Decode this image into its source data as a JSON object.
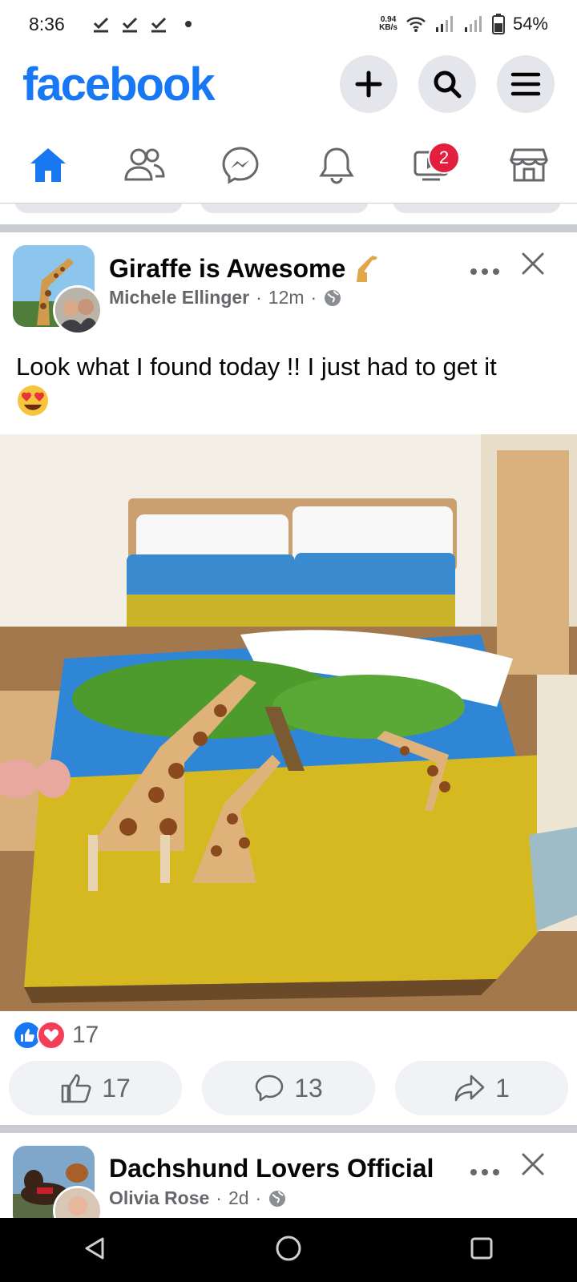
{
  "status_bar": {
    "time": "8:36",
    "speed_value": "0.94",
    "speed_unit": "KB/s",
    "battery": "54%"
  },
  "app": {
    "logo_text": "facebook",
    "brand_color": "#1877f2"
  },
  "nav_tabs": {
    "items": [
      "home-icon",
      "friends-icon",
      "messenger-icon",
      "notifications-icon",
      "watch-icon",
      "marketplace-icon"
    ],
    "watch_badge": "2"
  },
  "posts": [
    {
      "group": "Giraffe is Awesome",
      "author": "Michele Ellinger",
      "time": "12m",
      "text": "Look what I found today !! I just had to get it",
      "reaction_count": "17",
      "like_count": "17",
      "comment_count": "13",
      "share_count": "1"
    },
    {
      "group": "Dachshund Lovers Official",
      "author": "Olivia Rose",
      "time": "2d"
    }
  ]
}
